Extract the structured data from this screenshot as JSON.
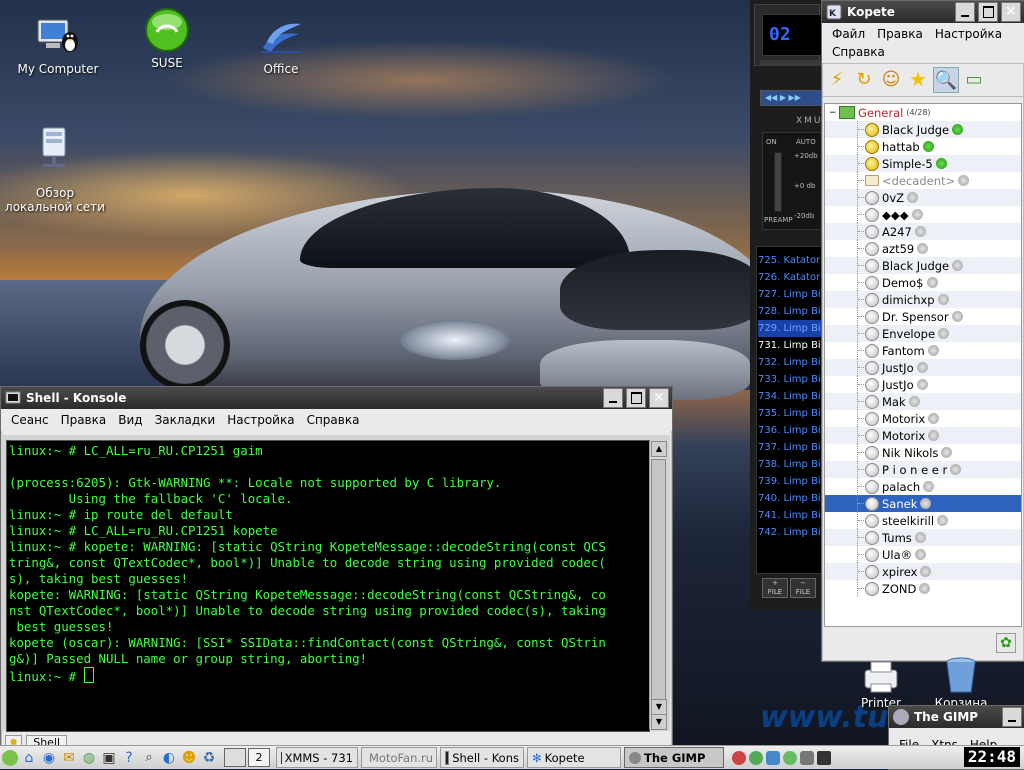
{
  "desktop": {
    "icons": [
      {
        "label": "My Computer"
      },
      {
        "label": "SUSE"
      },
      {
        "label": "Office"
      },
      {
        "label": "Обзор\nлокальной сети"
      },
      {
        "label": "Printer"
      },
      {
        "label": "Корзина"
      }
    ],
    "wallpaper_logo": "www.tu"
  },
  "konsole": {
    "title": "Shell - Konsole",
    "menu": [
      "Сеанс",
      "Правка",
      "Вид",
      "Закладки",
      "Настройка",
      "Справка"
    ],
    "terminal_lines": [
      "linux:~ # LC_ALL=ru_RU.CP1251 gaim",
      "",
      "(process:6205): Gtk-WARNING **: Locale not supported by C library.",
      "        Using the fallback 'C' locale.",
      "linux:~ # ip route del default",
      "linux:~ # LC_ALL=ru_RU.CP1251 kopete",
      "linux:~ # kopete: WARNING: [static QString KopeteMessage::decodeString(const QCS",
      "tring&, const QTextCodec*, bool*)] Unable to decode string using provided codec(",
      "s), taking best guesses!",
      "kopete: WARNING: [static QString KopeteMessage::decodeString(const QCString&, co",
      "nst QTextCodec*, bool*)] Unable to decode string using provided codec(s), taking",
      " best guesses!",
      "kopete (oscar): WARNING: [SSI* SSIData::findContact(const QString&, const QStrin",
      "g&)] Passed NULL name or group string, aborting!",
      "linux:~ # "
    ],
    "tab_label": "Shell"
  },
  "xmms": {
    "lcd": "02",
    "label_top": "XMU",
    "eq_labels": [
      "ON",
      "AUTO",
      "+20db",
      "+0 db",
      "-20db",
      "PREAMP"
    ],
    "playlist": [
      {
        "n": "725.",
        "t": "Katator"
      },
      {
        "n": "726.",
        "t": "Katator"
      },
      {
        "n": "727.",
        "t": "Limp Bi"
      },
      {
        "n": "728.",
        "t": "Limp Bi"
      },
      {
        "n": "729.",
        "t": "Limp Bi"
      },
      {
        "n": "731.",
        "t": "Limp Bi"
      },
      {
        "n": "732.",
        "t": "Limp Bi"
      },
      {
        "n": "733.",
        "t": "Limp Bi"
      },
      {
        "n": "734.",
        "t": "Limp Bi"
      },
      {
        "n": "735.",
        "t": "Limp Bi"
      },
      {
        "n": "736.",
        "t": "Limp Bi"
      },
      {
        "n": "737.",
        "t": "Limp Bi"
      },
      {
        "n": "738.",
        "t": "Limp Bi"
      },
      {
        "n": "739.",
        "t": "Limp Bi"
      },
      {
        "n": "740.",
        "t": "Limp Bi"
      },
      {
        "n": "741.",
        "t": "Limp Bi"
      },
      {
        "n": "742.",
        "t": "Limp Bi"
      }
    ],
    "buttons": [
      "+\nFILE",
      "−\nFILE"
    ]
  },
  "kopete": {
    "title": "Kopete",
    "menu": [
      "Файл",
      "Правка",
      "Настройка",
      "Справка"
    ],
    "group": {
      "name": "General",
      "count": "(4/28)"
    },
    "contacts": [
      {
        "name": "Black Judge",
        "online": true
      },
      {
        "name": "hattab",
        "online": true
      },
      {
        "name": "Simple-5",
        "online": true
      },
      {
        "name": "<decadent>",
        "online": false,
        "grey": true
      },
      {
        "name": "0vZ",
        "online": false
      },
      {
        "name": "◆◆◆",
        "online": false
      },
      {
        "name": "A247",
        "online": false
      },
      {
        "name": "azt59",
        "online": false
      },
      {
        "name": "Black Judge",
        "online": false
      },
      {
        "name": "Demo$",
        "online": false
      },
      {
        "name": "dimichxp",
        "online": false
      },
      {
        "name": "Dr. Spensor",
        "online": false
      },
      {
        "name": "Envelope",
        "online": false
      },
      {
        "name": "Fantom",
        "online": false
      },
      {
        "name": "JustJo",
        "online": false
      },
      {
        "name": "JustJo",
        "online": false
      },
      {
        "name": "Mak",
        "online": false
      },
      {
        "name": "Motorix",
        "online": false
      },
      {
        "name": "Motorix",
        "online": false
      },
      {
        "name": "Nik Nikols",
        "online": false
      },
      {
        "name": "P i o n e e r",
        "online": false
      },
      {
        "name": "palach",
        "online": false
      },
      {
        "name": "Sanek",
        "online": false,
        "selected": true
      },
      {
        "name": "steelkirill",
        "online": false
      },
      {
        "name": "Tums",
        "online": false
      },
      {
        "name": "Ula®",
        "online": false
      },
      {
        "name": "xpirex",
        "online": false
      },
      {
        "name": "ZOND",
        "online": false
      }
    ]
  },
  "gimp": {
    "title": "The GIMP",
    "menu": [
      "File",
      "Xtns",
      "Help"
    ]
  },
  "taskbar": {
    "desktop_num": "2",
    "tasks": [
      {
        "label": "XMMS - 731"
      },
      {
        "label": "MotoFan.ru"
      },
      {
        "label": "Shell - Kons"
      },
      {
        "label": "Kopete"
      },
      {
        "label": "The GIMP"
      }
    ],
    "clock": "22:48"
  },
  "colors": {
    "terminal_text": "#3fff3f",
    "selection": "#2f63c0"
  }
}
